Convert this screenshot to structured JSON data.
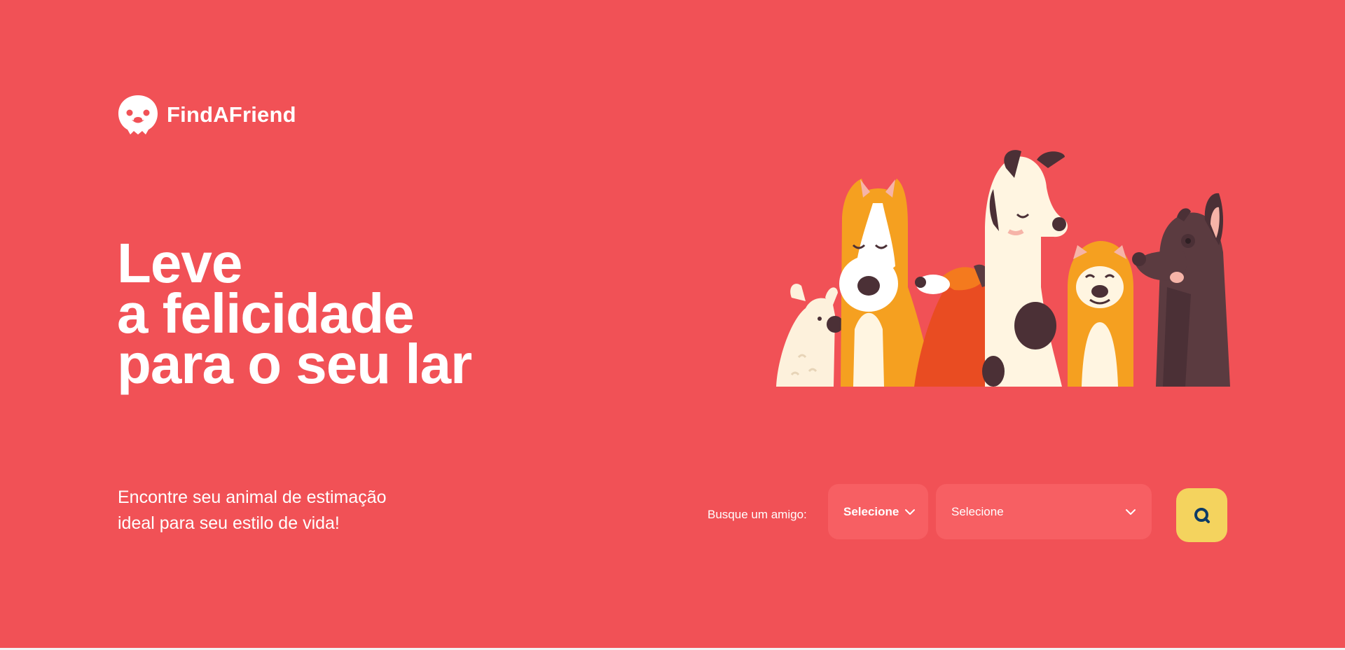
{
  "brand": {
    "name": "FindAFriend",
    "logo_icon": "dog-face-icon"
  },
  "hero": {
    "headline_lines": [
      "Leve",
      "a felicidade",
      "para o seu lar"
    ],
    "subtitle_lines": [
      "Encontre seu animal de estimação",
      "ideal para seu estilo de vida!"
    ],
    "illustration": "dogs-group-illustration"
  },
  "search": {
    "label": "Busque um amigo:",
    "state_select": {
      "value": "Selecione"
    },
    "city_select": {
      "value": "Selecione"
    },
    "button_icon": "search-icon"
  },
  "colors": {
    "background": "#F15156",
    "select_background": "#F75F63",
    "search_button": "#F4D35E",
    "search_icon": "#0D3B66",
    "text": "#FFFFFF"
  }
}
